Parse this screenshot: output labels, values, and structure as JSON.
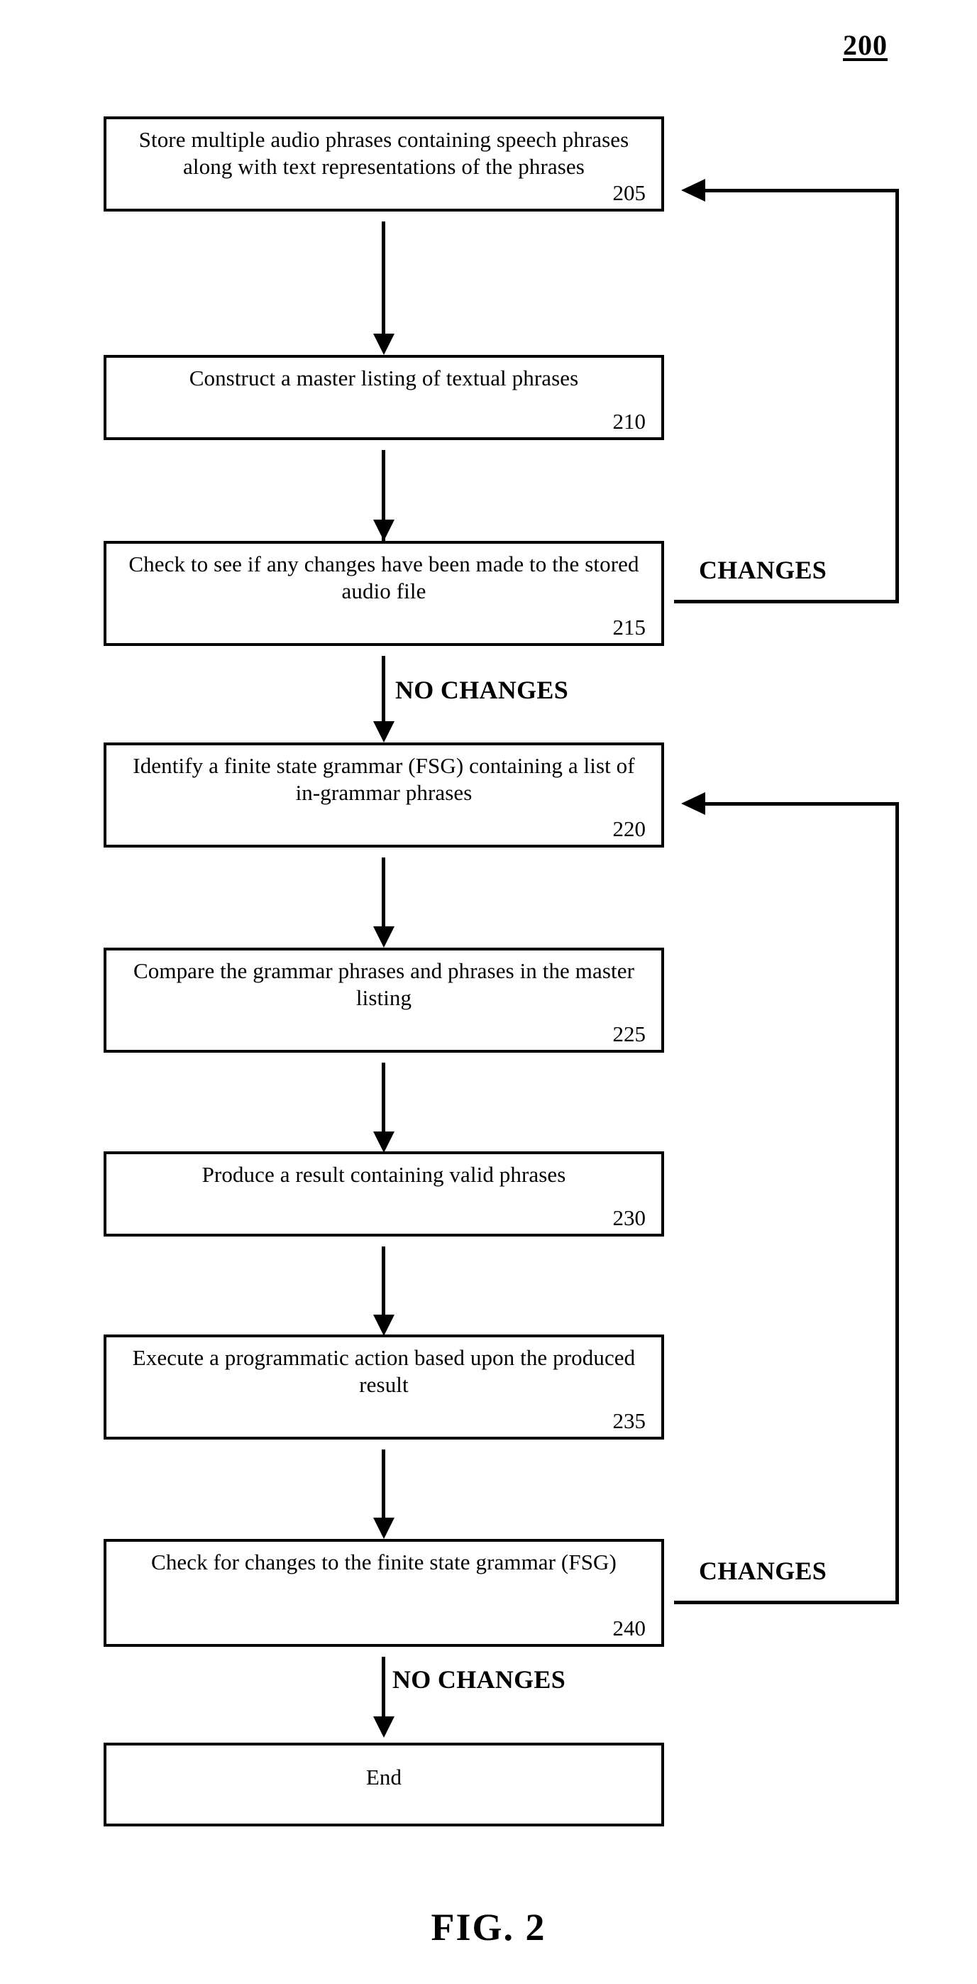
{
  "figure": {
    "number_label": "200",
    "caption": "FIG. 2"
  },
  "nodes": [
    {
      "id": "node-205",
      "text": "Store multiple audio phrases containing speech phrases along with text representations of the phrases",
      "ref": "205"
    },
    {
      "id": "node-210",
      "text": "Construct a master listing of textual phrases",
      "ref": "210"
    },
    {
      "id": "node-215",
      "text": "Check to see if any changes have been made to the stored audio file",
      "ref": "215"
    },
    {
      "id": "node-220",
      "text": "Identify a finite state grammar (FSG) containing a list of in-grammar phrases",
      "ref": "220"
    },
    {
      "id": "node-225",
      "text": "Compare the grammar phrases and phrases in the master listing",
      "ref": "225"
    },
    {
      "id": "node-230",
      "text": "Produce a result containing valid phrases",
      "ref": "230"
    },
    {
      "id": "node-235",
      "text": "Execute a programmatic action based upon the produced result",
      "ref": "235"
    },
    {
      "id": "node-240",
      "text": "Check for changes to the finite state grammar (FSG)",
      "ref": "240"
    },
    {
      "id": "node-end",
      "text": "End",
      "ref": ""
    }
  ],
  "branch_labels": {
    "changes_215": "CHANGES",
    "no_changes_215": "NO CHANGES",
    "changes_240": "CHANGES",
    "no_changes_240": "NO CHANGES"
  },
  "colors": {
    "ink": "#000000",
    "paper": "#ffffff"
  }
}
